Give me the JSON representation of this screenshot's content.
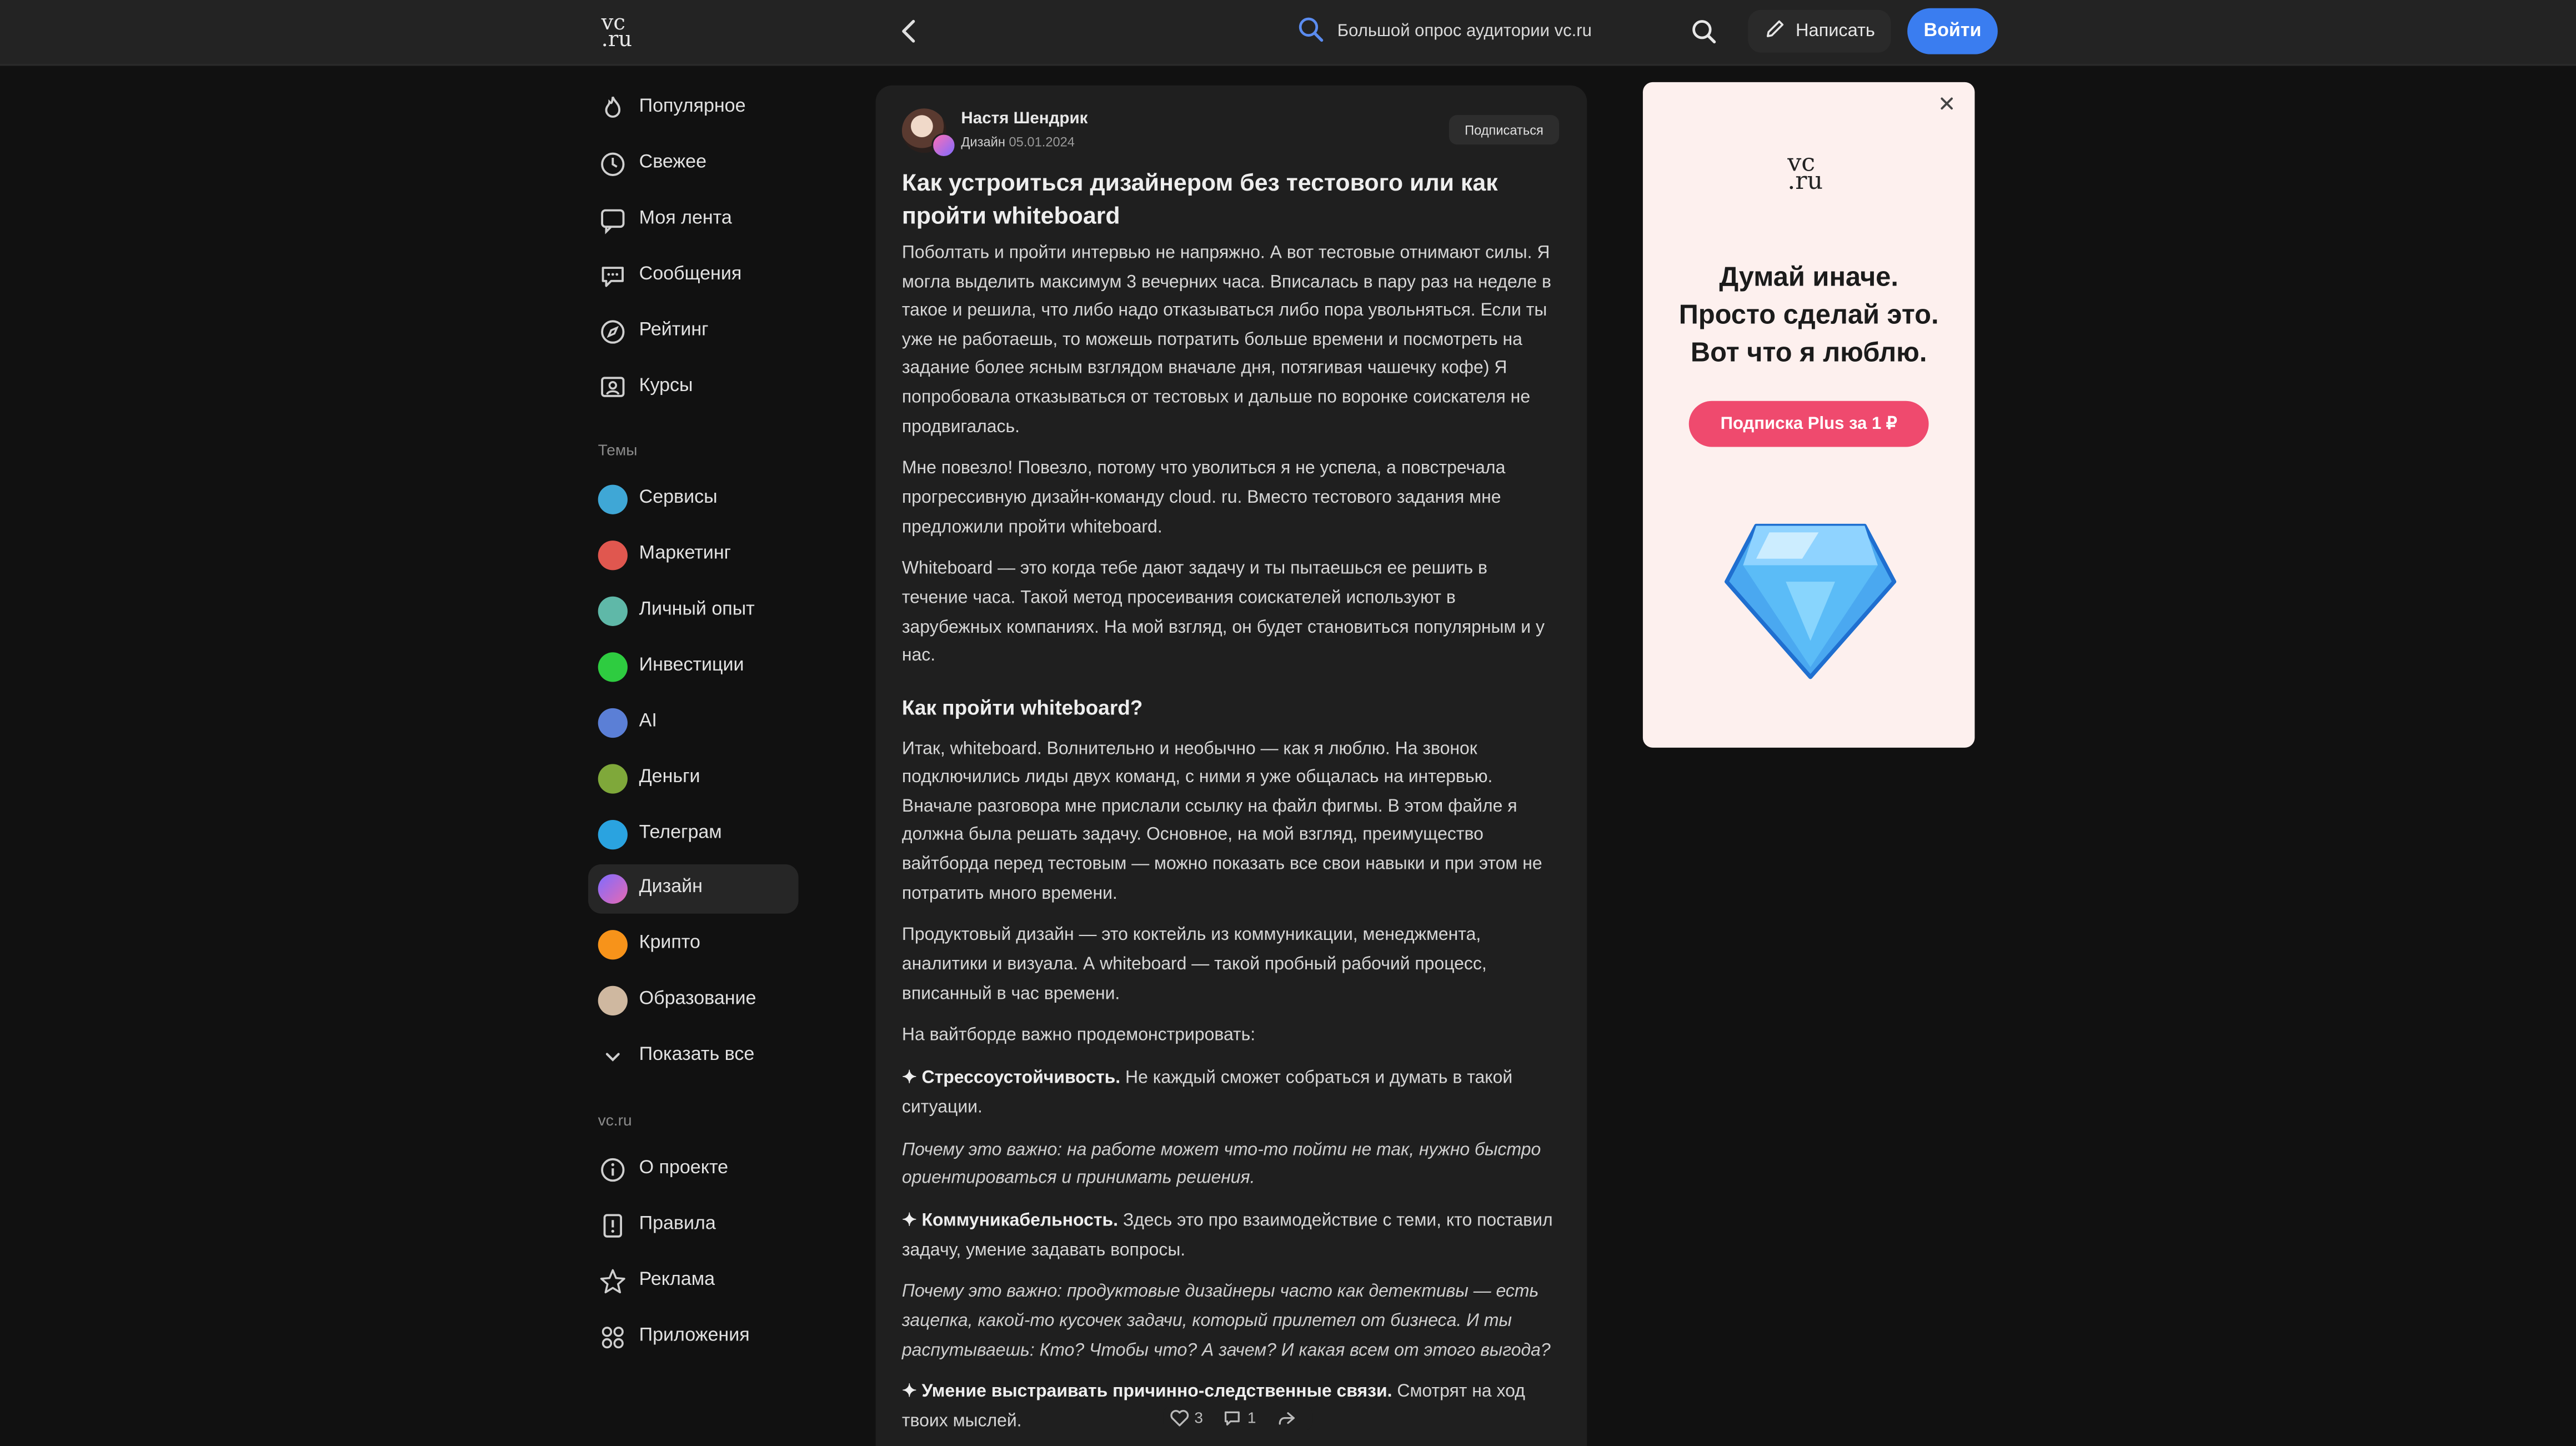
{
  "header": {
    "logo": {
      "line1": "vc",
      "line2": ".ru"
    },
    "search_text": "Большой опрос аудитории vc.ru",
    "write_label": "Написать",
    "login_label": "Войти"
  },
  "sidebar": {
    "main_items": [
      {
        "label": "Популярное",
        "icon": "flame-icon"
      },
      {
        "label": "Свежее",
        "icon": "clock-icon"
      },
      {
        "label": "Моя лента",
        "icon": "feed-icon"
      },
      {
        "label": "Сообщения",
        "icon": "chat-icon"
      },
      {
        "label": "Рейтинг",
        "icon": "compass-icon"
      },
      {
        "label": "Курсы",
        "icon": "courses-icon"
      }
    ],
    "topics_label": "Темы",
    "topics": [
      {
        "label": "Сервисы",
        "color": "#3fa7d6"
      },
      {
        "label": "Маркетинг",
        "color": "#e0574f"
      },
      {
        "label": "Личный опыт",
        "color": "#5fb8a8"
      },
      {
        "label": "Инвестиции",
        "color": "#2ecc40"
      },
      {
        "label": "AI",
        "color": "#5b7fd6"
      },
      {
        "label": "Деньги",
        "color": "#7fa83a"
      },
      {
        "label": "Телеграм",
        "color": "#2aa3e0"
      },
      {
        "label": "Дизайн",
        "color": "#b36de0",
        "active": true
      },
      {
        "label": "Крипто",
        "color": "#f7931a"
      },
      {
        "label": "Образование",
        "color": "#cfb8a0"
      }
    ],
    "show_all_label": "Показать все",
    "site_label": "vc.ru",
    "site_items": [
      {
        "label": "О проекте",
        "icon": "info-icon"
      },
      {
        "label": "Правила",
        "icon": "rules-icon"
      },
      {
        "label": "Реклама",
        "icon": "star-icon"
      },
      {
        "label": "Приложения",
        "icon": "apps-icon"
      }
    ]
  },
  "article": {
    "author": "Настя Шендрик",
    "category": "Дизайн",
    "date": "05.01.2024",
    "subscribe_label": "Подписаться",
    "title": "Как устроиться дизайнером без тестового или как пройти whiteboard",
    "p1": "Поболтать и пройти интервью не напряжно. А вот тестовые отнимают силы. Я могла выделить максимум 3 вечерних часа. Вписалась в пару раз на неделе в такое и решила, что либо надо отказываться либо пора увольняться. Если ты уже не работаешь, то можешь потратить больше времени и посмотреть на задание более ясным взглядом вначале дня, потягивая чашечку кофе) Я попробовала отказываться от тестовых и дальше по воронке соискателя не продвигалась.",
    "p2": "Мне повезло! Повезло, потому что уволиться я не успела, а повстречала прогрессивную дизайн-команду cloud. ru. Вместо тестового задания мне предложили пройти whiteboard.",
    "p3": "Whiteboard — это когда тебе дают задачу и ты пытаешься ее решить в течение часа. Такой метод просеивания соискателей используют в зарубежных компаниях. На мой взгляд, он будет становиться популярным и у нас.",
    "h2": "Как пройти whiteboard?",
    "p4": "Итак, whiteboard. Волнительно и необычно — как я люблю. На звонок подключились лиды двух команд, с ними я уже общалась на интервью. Вначале разговора мне прислали ссылку на файл фигмы. В этом файле я должна была решать задачу. Основное, на мой взгляд, преимущество вайтборда перед тестовым — можно показать все свои навыки и при этом не потратить много времени.",
    "p5": "Продуктовый дизайн — это коктейль из коммуникации, менеджмента, аналитики и визуала. А whiteboard — такой пробный рабочий процесс, вписанный в час времени.",
    "p6": "На вайтборде важно продемонстрировать:",
    "b1_title": "✦ Стрессоустойчивость.",
    "b1_text": " Не каждый сможет собраться и думать в такой ситуации.",
    "b1_why": "Почему это важно: на работе может что-то пойти не так, нужно быстро ориентироваться и принимать решения.",
    "b2_title": "✦ Коммуникабельность.",
    "b2_text": " Здесь это про взаимодействие с теми, кто поставил задачу, умение задавать вопросы.",
    "b2_why": "Почему это важно: продуктовые дизайнеры часто как детективы — есть зацепка, какой-то кусочек задачи, который прилетел от бизнеса. И ты распутываешь: Кто? Чтобы что? А зачем? И какая всем от этого выгода?",
    "b3_title": "✦ Умение выстраивать причинно-следственные связи.",
    "b3_text": " Смотрят на ход твоих мыслей.",
    "likes": "3",
    "comments": "1"
  },
  "ad": {
    "logo": {
      "line1": "vc",
      "line2": ".ru"
    },
    "headline_1": "Думай иначе.",
    "headline_2": "Просто сделай это.",
    "headline_3": "Вот что я люблю.",
    "button_label": "Подписка Plus за 1 ₽",
    "accent": "#ef4a6e"
  },
  "colors": {
    "background": "#111111",
    "topbar": "#232323",
    "panel": "#1f1f1f",
    "accent": "#3a7df0"
  }
}
